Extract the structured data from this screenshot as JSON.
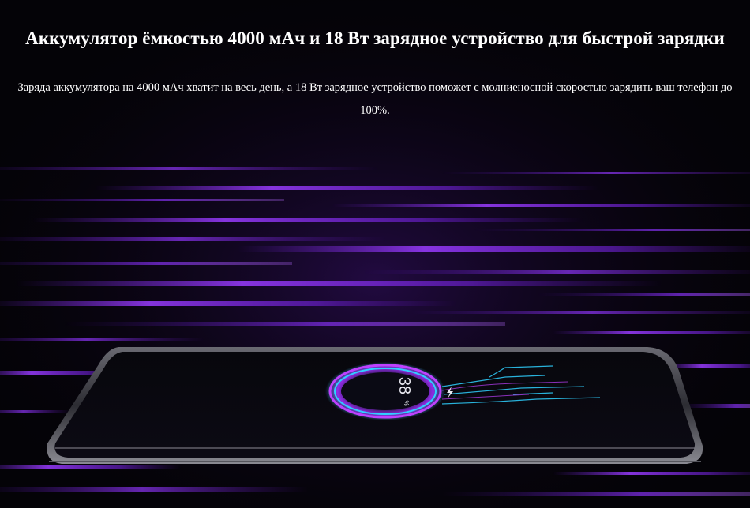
{
  "heading": "Аккумулятор ёмкостью 4000 мАч и 18 Вт зарядное устройство для быстрой зарядки",
  "description": "Заряда аккумулятора на 4000 мАч хватит на весь день, а 18 Вт зарядное устройство поможет с молниеносной скоростью зарядить ваш телефон до 100%.",
  "phone_screen": {
    "battery_percent": "38",
    "battery_unit": "%",
    "charge_icon": "lightning-bolt-icon"
  },
  "colors": {
    "background": "#040307",
    "streak_purple": "#8a2be2",
    "streak_violet": "#b04bff",
    "ring_cyan": "#2fd0ff",
    "ring_magenta": "#c040ff",
    "phone_frame": "#3a3a40"
  }
}
